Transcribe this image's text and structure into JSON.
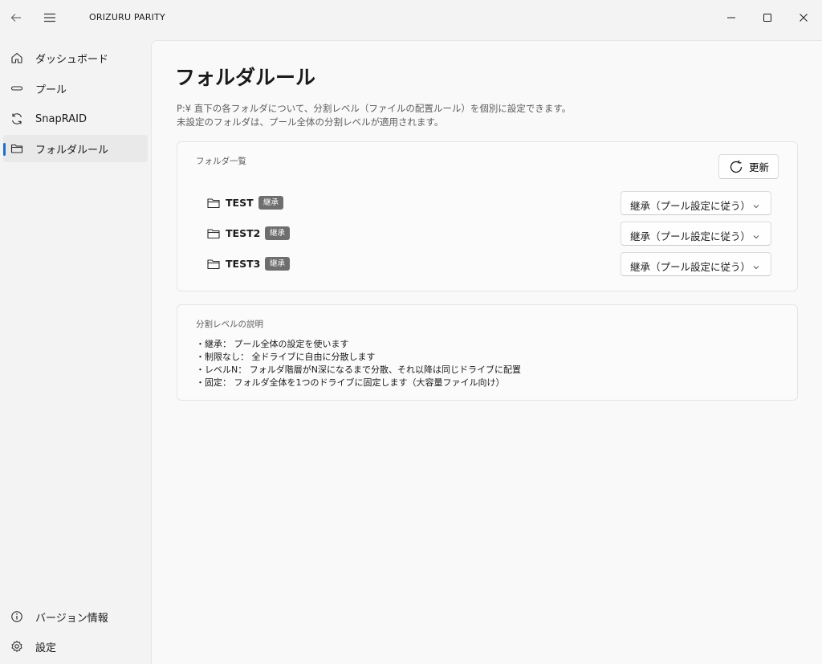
{
  "titlebar": {
    "app_title": "ORIZURU PARITY",
    "back_icon": "back-arrow-icon",
    "menu_icon": "hamburger-icon",
    "window_controls": [
      "minimize-icon",
      "maximize-icon",
      "close-icon"
    ]
  },
  "sidebar": {
    "items": [
      {
        "label": "ダッシュボード",
        "icon": "home-icon",
        "selected": false
      },
      {
        "label": "プール",
        "icon": "pool-icon",
        "selected": false
      },
      {
        "label": "SnapRAID",
        "icon": "sync-icon",
        "selected": false
      },
      {
        "label": "フォルダルール",
        "icon": "folder-icon",
        "selected": true
      }
    ],
    "footer_items": [
      {
        "label": "バージョン情報",
        "icon": "info-icon"
      },
      {
        "label": "設定",
        "icon": "gear-icon"
      }
    ]
  },
  "main": {
    "title": "フォルダルール",
    "description": [
      "P:¥ 直下の各フォルダについて、分割レベル（ファイルの配置ルール）を個別に設定できます。",
      "未設定のフォルダは、プール全体の分割レベルが適用されます。"
    ],
    "folder_card": {
      "caption": "フォルダ一覧",
      "refresh_label": "更新",
      "folders": [
        {
          "name": "TEST",
          "badge": "継承",
          "rule": "継承（プール設定に従う）"
        },
        {
          "name": "TEST2",
          "badge": "継承",
          "rule": "継承（プール設定に従う）"
        },
        {
          "name": "TEST3",
          "badge": "継承",
          "rule": "継承（プール設定に従う）"
        }
      ]
    },
    "explain_card": {
      "caption": "分割レベルの説明",
      "lines": [
        "・継承： プール全体の設定を使います",
        "・制限なし： 全ドライブに自由に分散します",
        "・レベルN： フォルダ階層がN深になるまで分散、それ以降は同じドライブに配置",
        "・固定： フォルダ全体を1つのドライブに固定します（大容量ファイル向け）"
      ]
    }
  },
  "colors": {
    "accent": "#1f6fc5",
    "badge_bg": "#6e6e6e",
    "window_bg": "#f3f3f3",
    "content_bg": "#f9f9f9"
  }
}
